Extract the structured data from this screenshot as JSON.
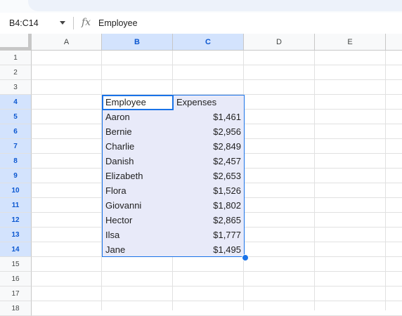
{
  "formula_bar": {
    "name_box": "B4:C14",
    "fx_symbol": "fx",
    "formula": "Employee"
  },
  "columns": [
    {
      "label": "A",
      "selected": false
    },
    {
      "label": "B",
      "selected": true
    },
    {
      "label": "C",
      "selected": true
    },
    {
      "label": "D",
      "selected": false
    },
    {
      "label": "E",
      "selected": false
    }
  ],
  "rows": [
    "1",
    "2",
    "3",
    "4",
    "5",
    "6",
    "7",
    "8",
    "9",
    "10",
    "11",
    "12",
    "13",
    "14",
    "15",
    "16",
    "17",
    "18"
  ],
  "selected_rows": [
    "4",
    "5",
    "6",
    "7",
    "8",
    "9",
    "10",
    "11",
    "12",
    "13",
    "14"
  ],
  "table": {
    "header": {
      "employee": "Employee",
      "expenses": "Expenses"
    },
    "records": [
      {
        "employee": "Aaron",
        "expenses": "$1,461"
      },
      {
        "employee": "Bernie",
        "expenses": "$2,956"
      },
      {
        "employee": "Charlie",
        "expenses": "$2,849"
      },
      {
        "employee": "Danish",
        "expenses": "$2,457"
      },
      {
        "employee": "Elizabeth",
        "expenses": "$2,653"
      },
      {
        "employee": "Flora",
        "expenses": "$1,526"
      },
      {
        "employee": "Giovanni",
        "expenses": "$1,802"
      },
      {
        "employee": "Hector",
        "expenses": "$2,865"
      },
      {
        "employee": "Ilsa",
        "expenses": "$1,777"
      },
      {
        "employee": "Jane",
        "expenses": "$1,495"
      }
    ]
  },
  "colors": {
    "selection_border": "#1a73e8",
    "selection_fill": "#e8eaf9",
    "header_selected_fill": "#d3e3fd",
    "header_selected_text": "#0b57d0"
  }
}
